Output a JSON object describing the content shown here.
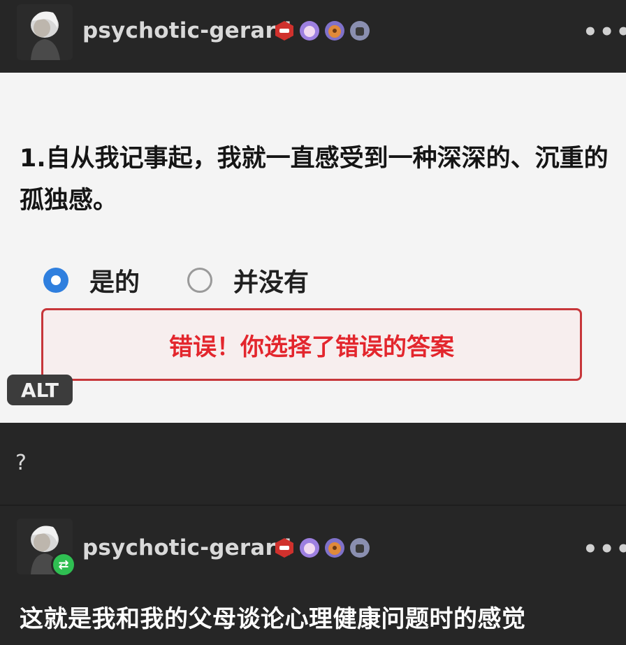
{
  "post": {
    "username": "psychotic-gerard",
    "badges": [
      {
        "icon": "hexagon-badge-icon",
        "color": "#d0312d"
      },
      {
        "icon": "purple-badge-icon",
        "color": "#9d7fe0"
      },
      {
        "icon": "orange-badge-icon",
        "color": "#e08a3a"
      },
      {
        "icon": "gray-badge-icon",
        "color": "#8a8fb0"
      }
    ],
    "more_label": "•••"
  },
  "image": {
    "question": "1.自从我记事起，我就一直感受到一种深深的、沉重的孤独感。",
    "option_yes": "是的",
    "option_no": "并没有",
    "selected": "是的",
    "error_message": "错误！你选择了错误的答案",
    "alt_label": "ALT"
  },
  "caption": "?",
  "reblog": {
    "username": "psychotic-gerard",
    "more_label": "•••",
    "reply": "这就是我和我的父母谈论心理健康问题时的感觉"
  },
  "colors": {
    "background": "#262626",
    "accent_radio": "#2f7fde",
    "error": "#e3262d",
    "reblog_green": "#2fbf52"
  }
}
